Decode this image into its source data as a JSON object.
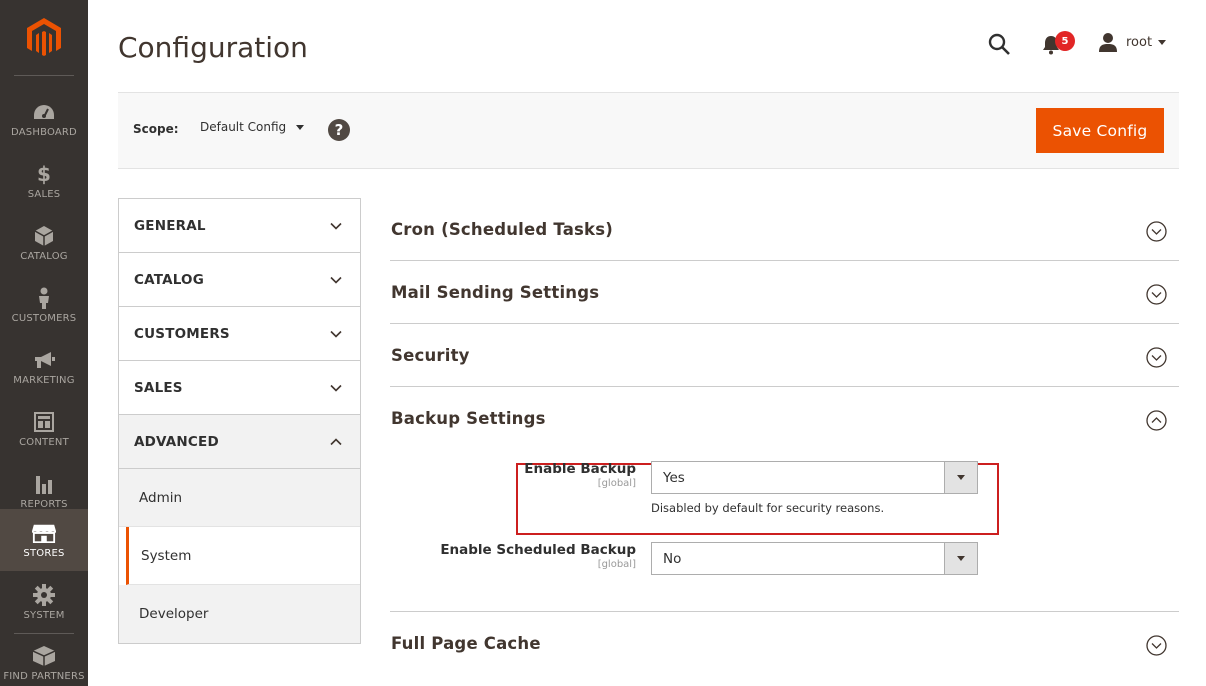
{
  "nav": {
    "items": [
      {
        "label": "DASHBOARD",
        "icon": "dashboard-icon"
      },
      {
        "label": "SALES",
        "icon": "dollar-icon"
      },
      {
        "label": "CATALOG",
        "icon": "box-icon"
      },
      {
        "label": "CUSTOMERS",
        "icon": "person-icon"
      },
      {
        "label": "MARKETING",
        "icon": "megaphone-icon"
      },
      {
        "label": "CONTENT",
        "icon": "layout-icon"
      },
      {
        "label": "REPORTS",
        "icon": "bar-chart-icon"
      },
      {
        "label": "STORES",
        "icon": "store-icon"
      },
      {
        "label": "SYSTEM",
        "icon": "gear-icon"
      },
      {
        "label": "FIND PARTNERS",
        "icon": "partners-box-icon"
      }
    ],
    "active": "STORES"
  },
  "header": {
    "title": "Configuration",
    "notification_count": "5",
    "user": "root"
  },
  "scope": {
    "label": "Scope:",
    "value": "Default Config",
    "help": "?",
    "save_label": "Save Config"
  },
  "tabs": [
    {
      "label": "GENERAL"
    },
    {
      "label": "CATALOG"
    },
    {
      "label": "CUSTOMERS"
    },
    {
      "label": "SALES"
    },
    {
      "label": "ADVANCED",
      "subtabs": [
        {
          "label": "Admin"
        },
        {
          "label": "System"
        },
        {
          "label": "Developer"
        }
      ]
    }
  ],
  "sections": {
    "cron": "Cron (Scheduled Tasks)",
    "mail": "Mail Sending Settings",
    "security": "Security",
    "backup": "Backup Settings",
    "fpc": "Full Page Cache"
  },
  "backup_fields": {
    "enable_backup": {
      "label": "Enable Backup",
      "scope": "[global]",
      "value": "Yes",
      "note": "Disabled by default for security reasons."
    },
    "enable_scheduled": {
      "label": "Enable Scheduled Backup",
      "scope": "[global]",
      "value": "No"
    }
  },
  "colors": {
    "accent": "#eb5202",
    "nav_bg": "#373330",
    "highlight": "#cc1f1f"
  }
}
